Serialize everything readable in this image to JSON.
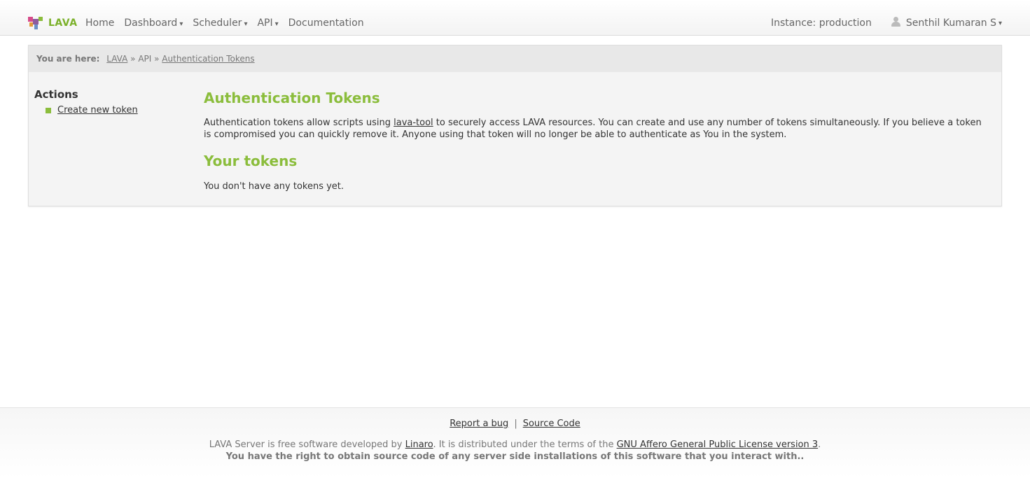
{
  "navbar": {
    "brand": "LAVA",
    "items": [
      {
        "label": "Home",
        "dropdown": false
      },
      {
        "label": "Dashboard",
        "dropdown": true
      },
      {
        "label": "Scheduler",
        "dropdown": true
      },
      {
        "label": "API",
        "dropdown": true
      },
      {
        "label": "Documentation",
        "dropdown": false
      }
    ],
    "instance": "Instance: production",
    "user": "Senthil Kumaran S",
    "caret": "▾"
  },
  "breadcrumb": {
    "label": "You are here:",
    "crumbs": [
      "LAVA",
      "API",
      "Authentication Tokens"
    ],
    "separator": "»"
  },
  "sidebar": {
    "title": "Actions",
    "items": [
      {
        "label": "Create new token"
      }
    ]
  },
  "main": {
    "title": "Authentication Tokens",
    "desc_before_link": "Authentication tokens allow scripts using ",
    "desc_link": "lava-tool",
    "desc_after_link": " to securely access LAVA resources. You can create and use any number of tokens simultaneously. If you believe a token is compromised you can quickly remove it. Anyone using that token will no longer be able to authenticate as You in the system.",
    "tokens_title": "Your tokens",
    "tokens_empty": "You don't have any tokens yet."
  },
  "footer": {
    "report_bug": "Report a bug",
    "link_separator": "|",
    "source_code": "Source Code",
    "license_1": "LAVA Server is free software developed by ",
    "linaro": "Linaro",
    "license_2": ". It is distributed under the terms of the ",
    "license_link": "GNU Affero General Public License version 3",
    "license_3": ".",
    "rights": "You have the right to obtain source code of any server side installations of this software that you interact with.."
  },
  "colors": {
    "accent_green": "#8bbd3c",
    "brand_green": "#7cb12b",
    "logo_pink": "#d64b8a",
    "logo_purple": "#8e5c9e",
    "logo_orange": "#e39a3b",
    "logo_green": "#8bbd3c"
  },
  "icons": {
    "logo": "lava-logo-icon",
    "user": "user-icon",
    "bullet": "square-bullet-icon"
  }
}
